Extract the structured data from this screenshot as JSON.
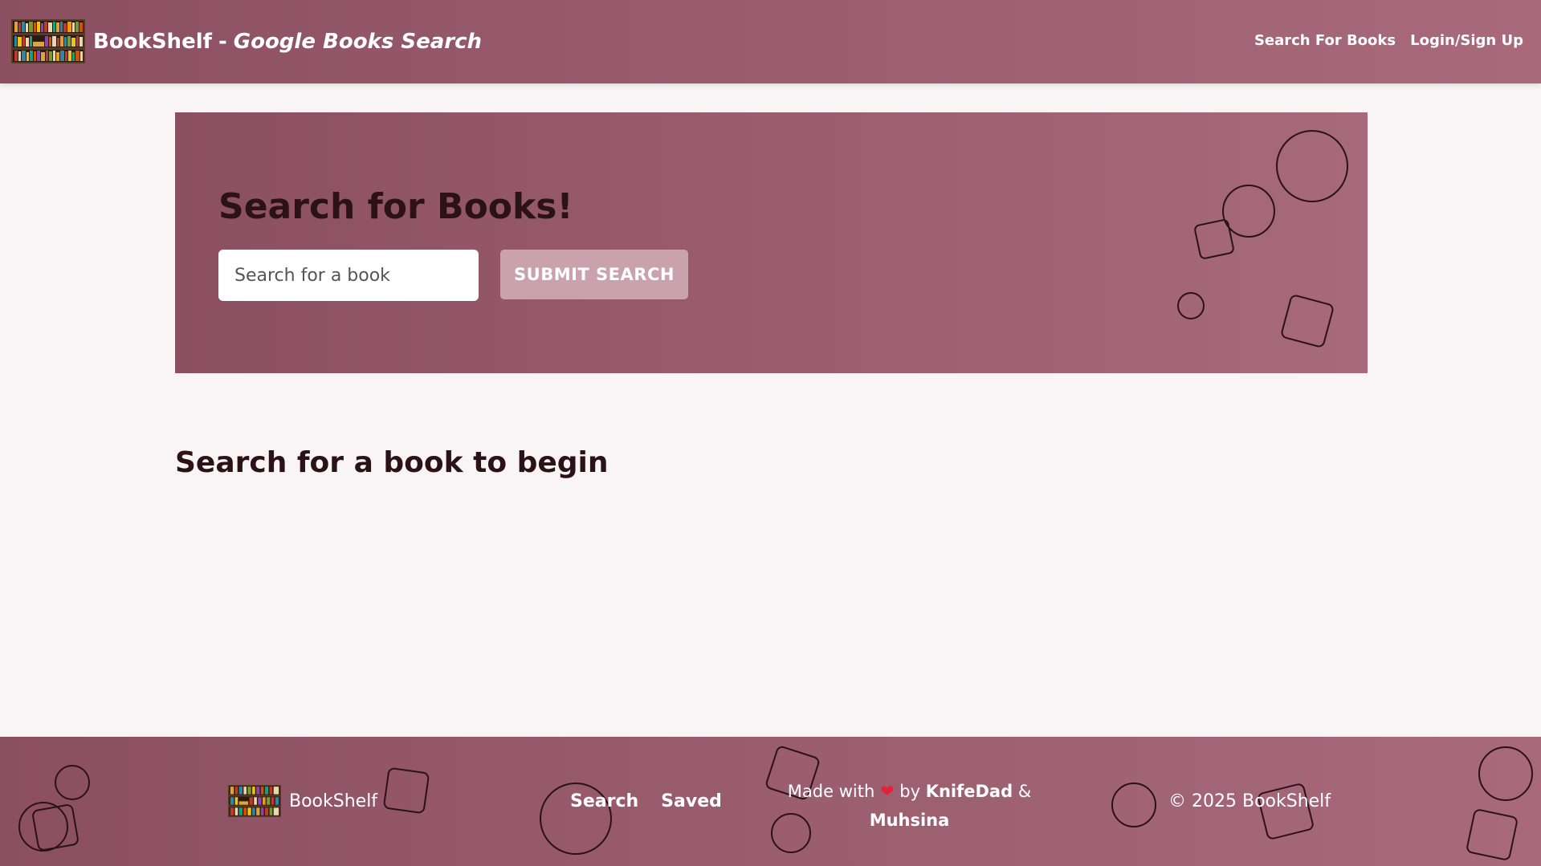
{
  "navbar": {
    "brand_name": "BookShelf",
    "brand_separator": "-",
    "brand_subtitle": "Google Books Search",
    "links": [
      {
        "label": "Search For Books"
      },
      {
        "label": "Login/Sign Up"
      }
    ]
  },
  "hero": {
    "title": "Search for Books!",
    "search_placeholder": "Search for a book",
    "search_value": "",
    "submit_label": "SUBMIT SEARCH"
  },
  "results": {
    "heading": "Search for a book to begin"
  },
  "footer": {
    "brand_name": "BookShelf",
    "nav": [
      {
        "label": "Search"
      },
      {
        "label": "Saved"
      }
    ],
    "credit": {
      "made_with": "Made with",
      "heart": "❤",
      "by": "by",
      "author1": "KnifeDad",
      "amp": "&",
      "author2": "Muhsina"
    },
    "copyright": "© 2025 BookShelf"
  },
  "colors": {
    "primary": "#8b4f62",
    "primary_light": "#a86a7b",
    "button": "#c9a2ad",
    "background": "#f9f4f5",
    "text_dark": "#2a1217"
  }
}
